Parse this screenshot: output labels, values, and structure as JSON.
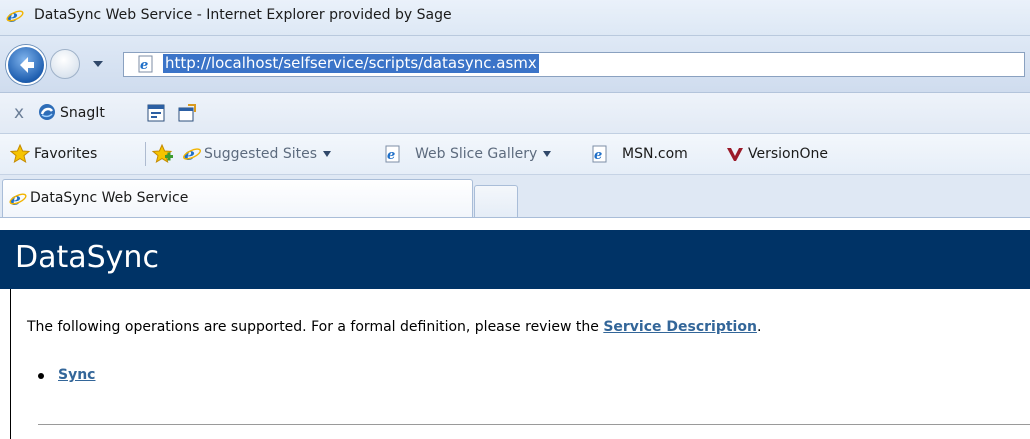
{
  "window": {
    "title": "DataSync Web Service - Internet Explorer provided by Sage"
  },
  "address_bar": {
    "url": "http://localhost/selfservice/scripts/datasync.asmx"
  },
  "toolbar": {
    "close_glyph": "x",
    "snagit_label": "SnagIt"
  },
  "favorites_bar": {
    "favorites_label": "Favorites",
    "items": [
      {
        "label": "Suggested Sites",
        "has_dropdown": true
      },
      {
        "label": "Web Slice Gallery",
        "has_dropdown": true
      },
      {
        "label": "MSN.com",
        "has_dropdown": false
      },
      {
        "label": "VersionOne",
        "has_dropdown": false
      }
    ]
  },
  "tabs": [
    {
      "label": "DataSync Web Service",
      "active": true
    }
  ],
  "page": {
    "heading": "DataSync",
    "intro_text": "The following operations are supported. For a formal definition, please review the",
    "service_description_link": "Service Description",
    "intro_suffix": ".",
    "operations": [
      "Sync"
    ]
  },
  "colors": {
    "header_bg": "#003366",
    "link": "#336699",
    "url_highlight": "#3b74c8"
  }
}
